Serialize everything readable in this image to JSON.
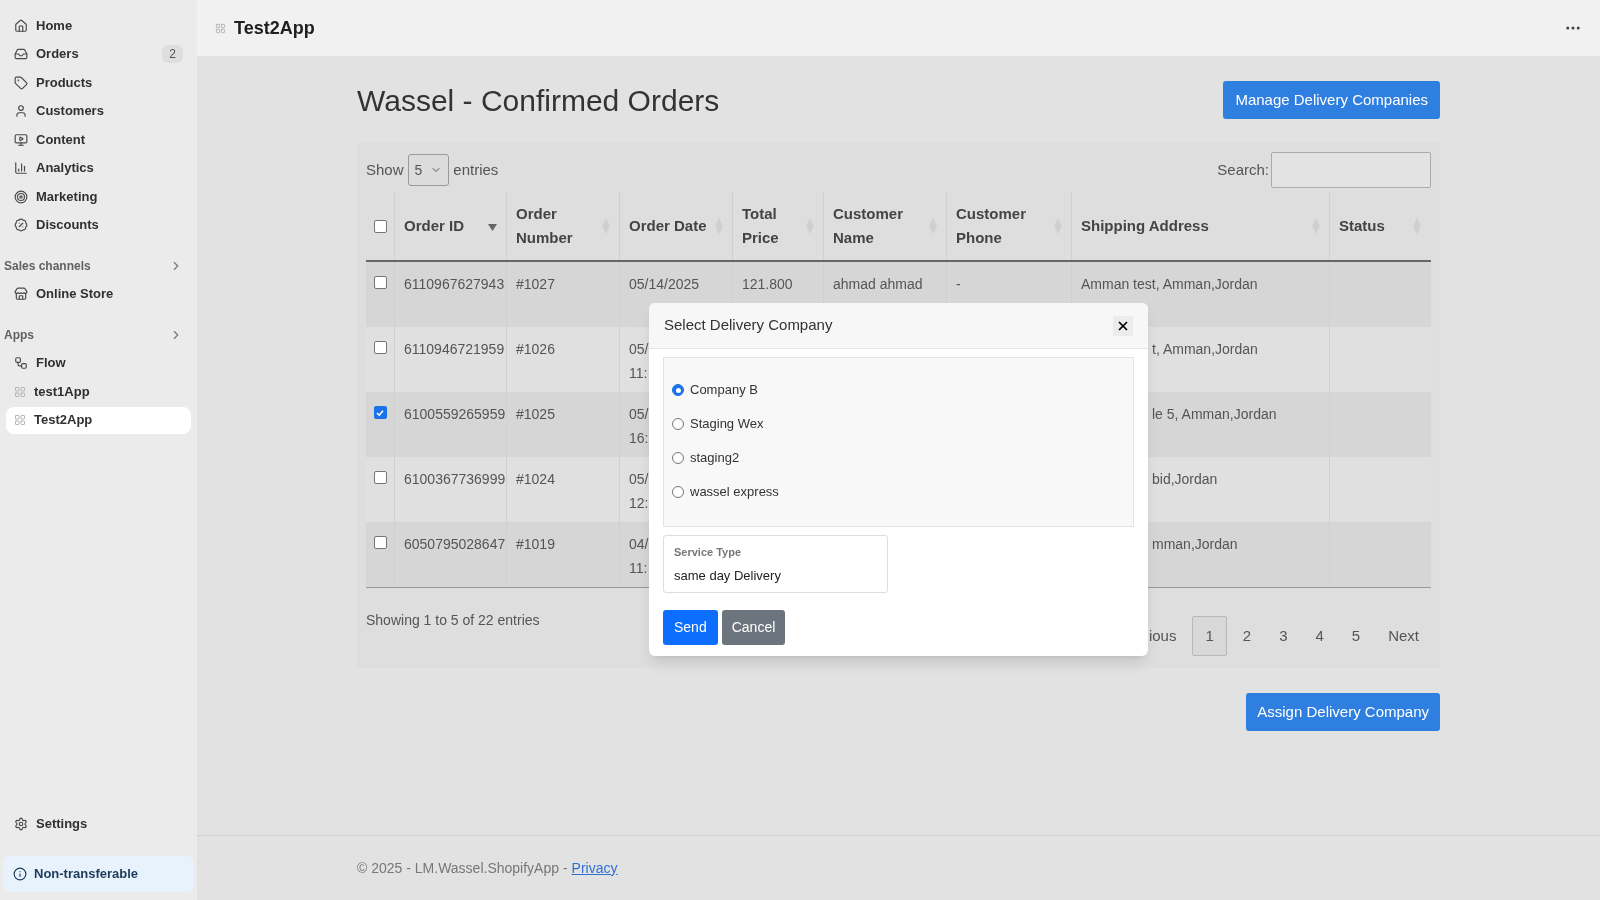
{
  "sidebar": {
    "items": [
      {
        "label": "Home",
        "selected": false
      },
      {
        "label": "Orders",
        "badge": "2",
        "selected": false
      },
      {
        "label": "Products",
        "selected": false
      },
      {
        "label": "Customers",
        "selected": false
      },
      {
        "label": "Content",
        "selected": false
      },
      {
        "label": "Analytics",
        "selected": false
      },
      {
        "label": "Marketing",
        "selected": false
      },
      {
        "label": "Discounts",
        "selected": false
      }
    ],
    "sections": [
      {
        "title": "Sales channels",
        "items": [
          {
            "label": "Online Store",
            "selected": false
          }
        ]
      },
      {
        "title": "Apps",
        "items": [
          {
            "label": "Flow",
            "selected": false
          },
          {
            "label": "test1App",
            "selected": false
          },
          {
            "label": "Test2App",
            "selected": true
          }
        ]
      }
    ],
    "settings": "Settings",
    "notice": "Non-transferable"
  },
  "top_bar": {
    "title": "Test2App"
  },
  "page": {
    "title": "Wassel - Confirmed Orders",
    "manage_button": "Manage Delivery Companies",
    "show_label": "Show",
    "entries_value": "5",
    "entries_label": "entries",
    "search_label": "Search:",
    "table": {
      "select_all_checked": false,
      "columns": [
        "Order ID",
        "Order Number",
        "Order Date",
        "Total Price",
        "Customer Name",
        "Customer Phone",
        "Shipping Address",
        "Status"
      ],
      "rows": [
        {
          "checked": false,
          "covered": false,
          "cells": [
            "6110967627943",
            "#1027",
            "05/14/2025",
            "121.800",
            "ahmad ahmad",
            "-",
            "Amman test, Amman,Jordan",
            ""
          ]
        },
        {
          "checked": false,
          "covered": true,
          "cells": [
            "6110946721959",
            "#1026",
            "05/ 11:",
            "",
            "",
            "",
            "t, Amman,Jordan",
            ""
          ]
        },
        {
          "checked": true,
          "covered": true,
          "cells": [
            "6100559265959",
            "#1025",
            "05/ 16:",
            "",
            "",
            "",
            "le 5, Amman,Jordan",
            ""
          ]
        },
        {
          "checked": false,
          "covered": true,
          "cells": [
            "6100367736999",
            "#1024",
            "05/ 12:",
            "",
            "",
            "",
            "bid,Jordan",
            ""
          ]
        },
        {
          "checked": false,
          "covered": true,
          "cells": [
            "6050795028647",
            "#1019",
            "04/ 11:",
            "",
            "",
            "",
            "mman,Jordan",
            ""
          ]
        }
      ]
    },
    "info": "Showing 1 to 5 of 22 entries",
    "pagination": [
      {
        "label": "ious",
        "selected": false
      },
      {
        "label": "1",
        "selected": true
      },
      {
        "label": "2",
        "selected": false
      },
      {
        "label": "3",
        "selected": false
      },
      {
        "label": "4",
        "selected": false
      },
      {
        "label": "5",
        "selected": false
      },
      {
        "label": "Next",
        "selected": false
      }
    ],
    "assign_button": "Assign Delivery Company"
  },
  "dialog": {
    "title": "Select Delivery Company",
    "options": [
      {
        "label": "Company B",
        "selected": true
      },
      {
        "label": "Staging Wex",
        "selected": false
      },
      {
        "label": "staging2",
        "selected": false
      },
      {
        "label": "wassel express",
        "selected": false
      }
    ],
    "service_type": {
      "label": "Service Type",
      "value": "same day Delivery"
    },
    "send": "Send",
    "cancel": "Cancel"
  },
  "footer": {
    "text": "© 2025 - LM.Wassel.ShopifyApp -",
    "link": "Privacy"
  }
}
